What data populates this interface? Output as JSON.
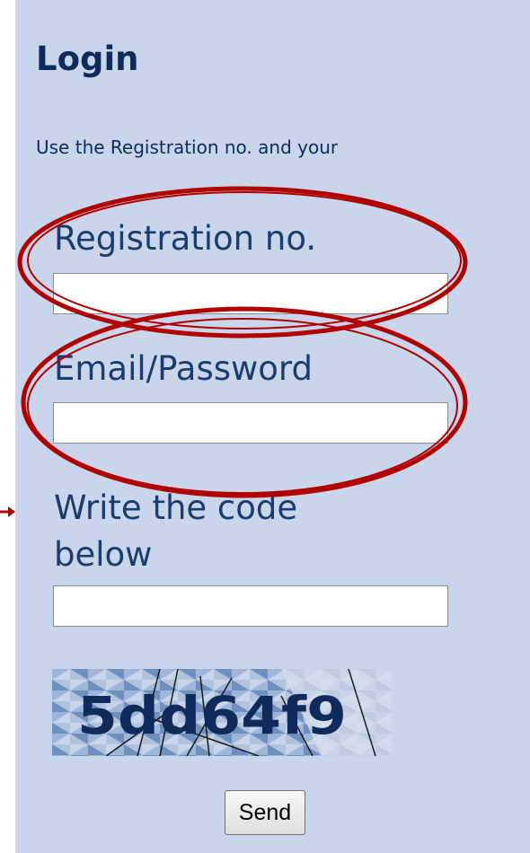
{
  "login": {
    "title": "Login",
    "instructions": "Use the Registration no. and your"
  },
  "fields": {
    "registration_label": "Registration no.",
    "registration_value": "",
    "password_label": "Email/Password",
    "password_value": "",
    "code_label_line1": "Write the code",
    "code_label_line2": "below",
    "code_value": ""
  },
  "captcha": {
    "text": "5dd64f9"
  },
  "actions": {
    "send_label": "Send"
  },
  "colors": {
    "panel_background": "#c8d5ea",
    "heading": "#0f2b5b",
    "label": "#1b3c6e",
    "annotation": "#b00000"
  },
  "annotations": {
    "highlight_color": "#b00000",
    "highlighted_fields": [
      "registration-field",
      "email-password-field"
    ]
  }
}
